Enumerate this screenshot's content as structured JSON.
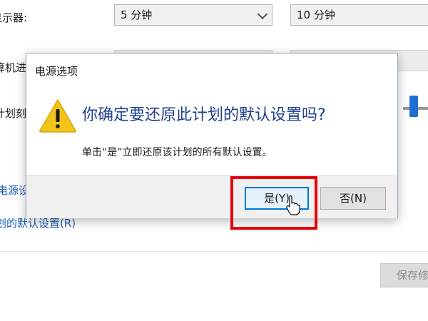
{
  "background_window": {
    "row1_label": "显示器:",
    "row2_label": "算机进",
    "row3_label": "计划刻",
    "display_off_on_battery": "5 分钟",
    "display_off_plugged_in": "10 分钟",
    "link_power_settings": "电源设",
    "link_restore_defaults": "划的默认设置(R)",
    "save_button_label": "保存修"
  },
  "dialog": {
    "title": "电源选项",
    "icon": "warning-icon",
    "main_instruction": "你确定要还原此计划的默认设置吗?",
    "content": "单击“是”立即还原该计划的所有默认设置。",
    "yes_button": "是(Y)",
    "no_button": "否(N)"
  },
  "annotation": {
    "highlight_color": "#e3000b",
    "cursor_icon": "pointer-cursor-icon"
  },
  "colors": {
    "main_instruction": "#1e3f8f",
    "link": "#1a5fb4",
    "focus_border": "#0078d7",
    "warning_fill": "#f0c419"
  }
}
